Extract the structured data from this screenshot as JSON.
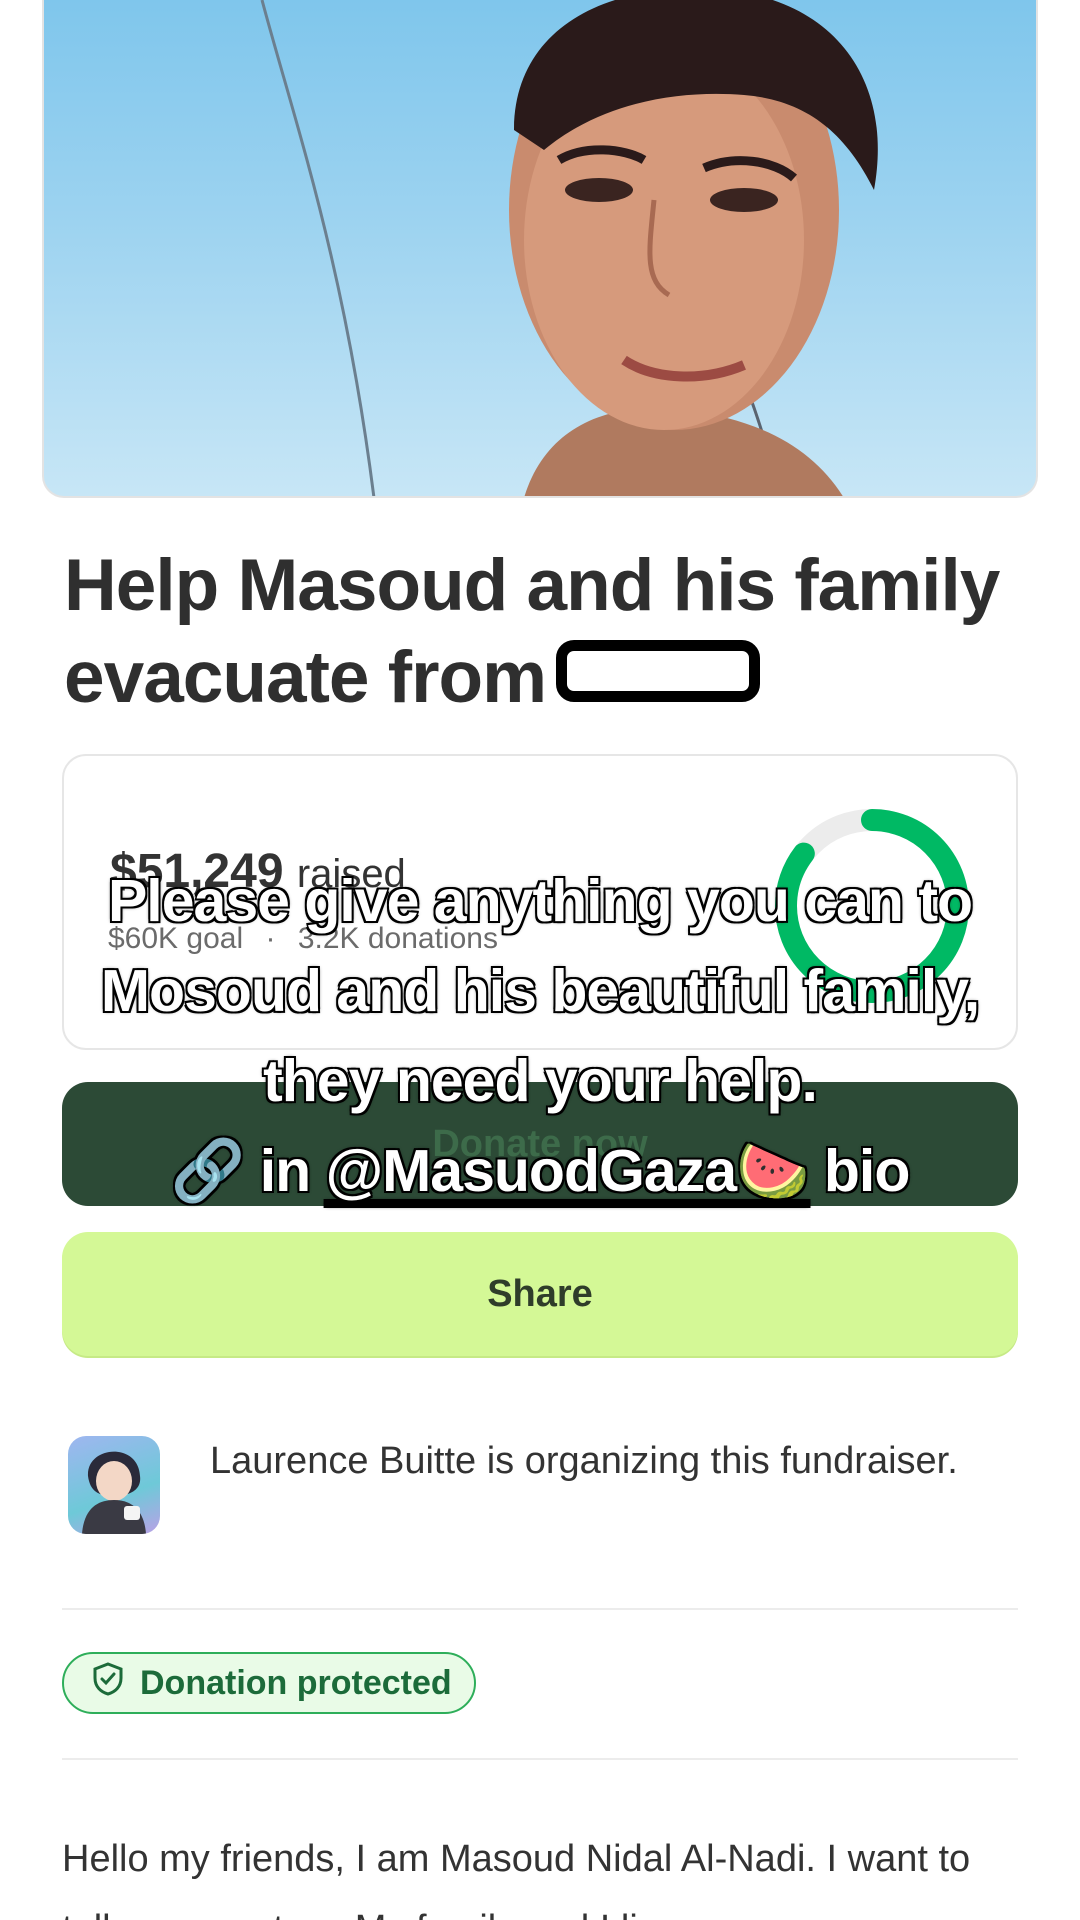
{
  "campaign": {
    "title_line1": "Help Masoud and his family",
    "title_line2": "evacuate from"
  },
  "progress": {
    "raised_amount": "$51,249",
    "raised_label": "raised",
    "goal": "$60K goal",
    "separator": "·",
    "donations": "3.2K donations",
    "fraction": 0.854,
    "ring_color": "#00b964"
  },
  "buttons": {
    "donate_label": "Donate now",
    "share_label": "Share"
  },
  "organizer": {
    "text": "Laurence Buitte is organizing this fundraiser."
  },
  "badge": {
    "label": "Donation protected",
    "icon": "shield-icon"
  },
  "story": {
    "text": "Hello my friends, I am Masoud Nidal Al-Nadi. I want to tell you my story. My family and I live"
  },
  "overlay": {
    "line1": "Please give anything you can to",
    "line2": "Mosoud and his beautiful family,",
    "line3": "they need your help.",
    "link_icon": "🔗",
    "line4_prefix": "in",
    "handle": "@MasuodGaza🍉",
    "line4_suffix": "bio"
  },
  "colors": {
    "donate_bg": "#2c4a36",
    "share_bg": "#d4f896",
    "badge_border": "#2eae5a"
  }
}
